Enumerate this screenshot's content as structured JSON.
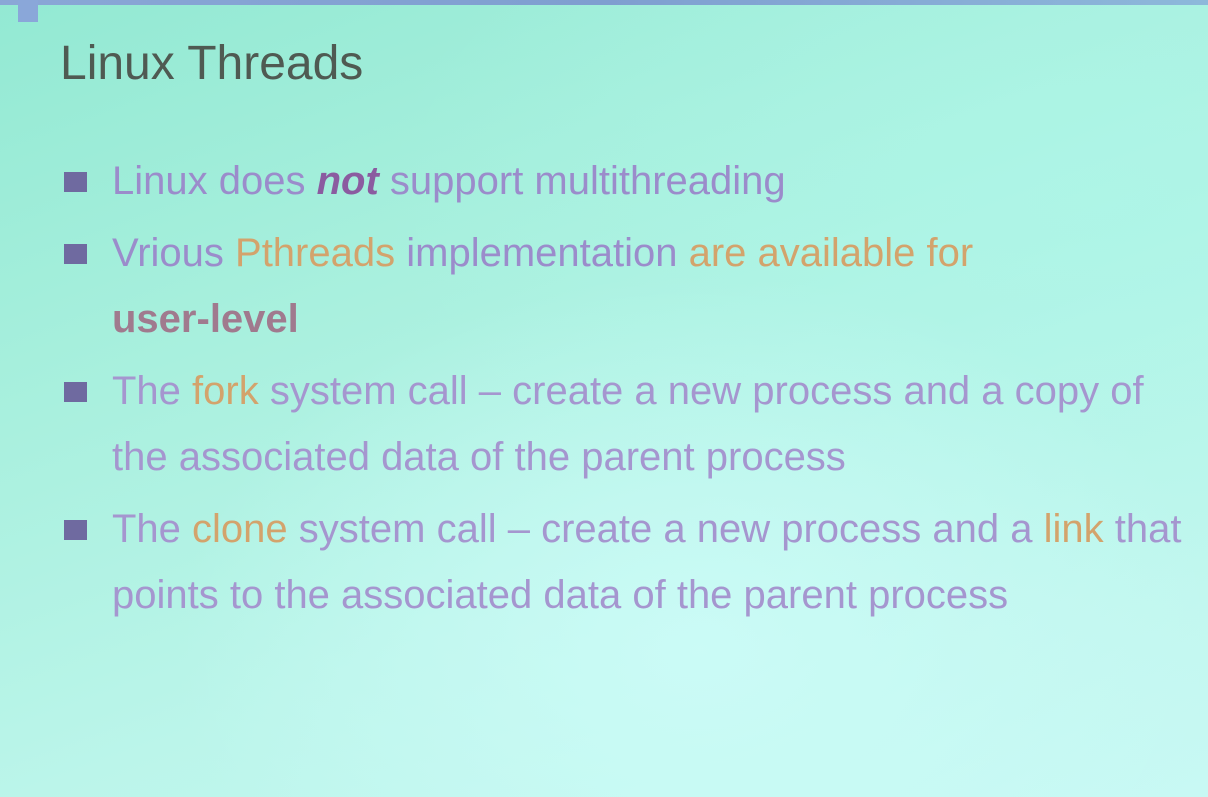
{
  "slide": {
    "title": "Linux Threads",
    "bullets": [
      {
        "parts": [
          "Linux does ",
          "not",
          " support multithreading"
        ]
      },
      {
        "parts": [
          "Vrious ",
          "Pthreads",
          " implementation ",
          "are available for",
          "user-level"
        ]
      },
      {
        "parts": [
          "The ",
          "fork",
          " system call – create a new process and a copy of the associated data of the parent process"
        ]
      },
      {
        "parts": [
          "The ",
          "clone",
          " system call – create a new process and a ",
          "link",
          " that points to the associated data of the parent process"
        ]
      }
    ]
  },
  "colors": {
    "background": "#a9f0de",
    "title": "#4f5a52",
    "bullet_text": "#a596cf",
    "highlight": "#d3a36c",
    "bullet_marker": "#6f6aa0"
  }
}
